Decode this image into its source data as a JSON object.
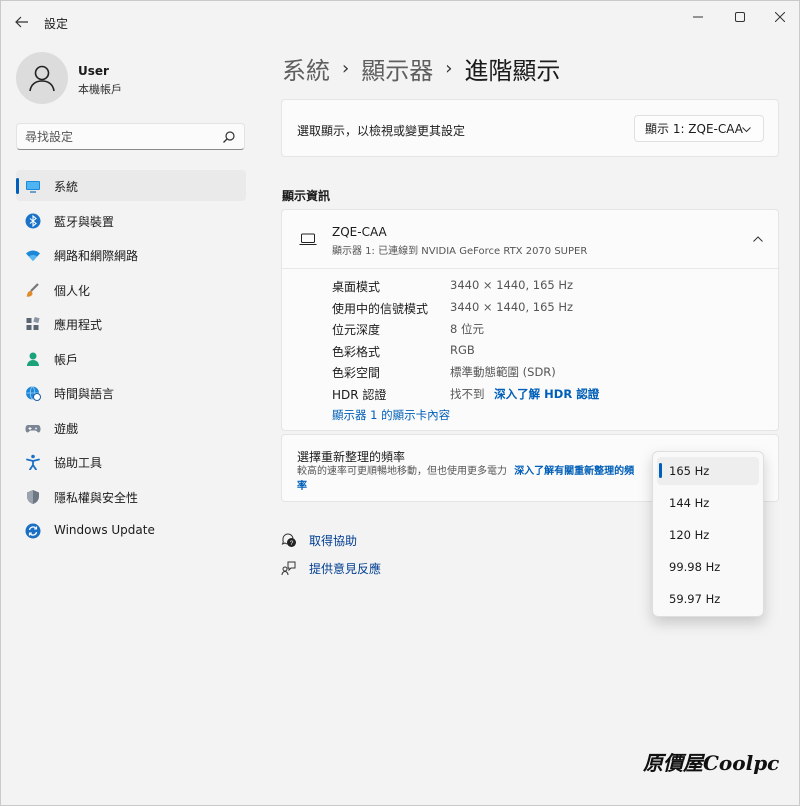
{
  "window": {
    "title": "設定",
    "controls": [
      "minimize-icon",
      "maximize-icon",
      "close-icon"
    ]
  },
  "user": {
    "name": "User",
    "account_type": "本機帳戶"
  },
  "search": {
    "placeholder": "尋找設定"
  },
  "nav": {
    "items": [
      {
        "label": "系統",
        "icon": "monitor-icon",
        "active": true
      },
      {
        "label": "藍牙與裝置",
        "icon": "bluetooth-icon"
      },
      {
        "label": "網路和網際網路",
        "icon": "wifi-icon"
      },
      {
        "label": "個人化",
        "icon": "brush-icon"
      },
      {
        "label": "應用程式",
        "icon": "apps-icon"
      },
      {
        "label": "帳戶",
        "icon": "person-icon"
      },
      {
        "label": "時間與語言",
        "icon": "globe-clock-icon"
      },
      {
        "label": "遊戲",
        "icon": "gamepad-icon"
      },
      {
        "label": "協助工具",
        "icon": "accessibility-icon"
      },
      {
        "label": "隱私權與安全性",
        "icon": "shield-icon"
      },
      {
        "label": "Windows Update",
        "icon": "update-icon"
      }
    ]
  },
  "breadcrumb": {
    "part1": "系統",
    "part2": "顯示器",
    "current": "進階顯示"
  },
  "select_display": {
    "label": "選取顯示，以檢視或變更其設定",
    "value": "顯示 1: ZQE-CAA"
  },
  "display_info": {
    "section_title": "顯示資訊",
    "monitor_name": "ZQE-CAA",
    "monitor_sub": "顯示器 1: 已連線到 NVIDIA GeForce RTX 2070 SUPER",
    "rows": [
      {
        "key": "桌面模式",
        "value": "3440 × 1440, 165 Hz"
      },
      {
        "key": "使用中的信號模式",
        "value": "3440 × 1440, 165 Hz"
      },
      {
        "key": "位元深度",
        "value": "8 位元"
      },
      {
        "key": "色彩格式",
        "value": "RGB"
      },
      {
        "key": "色彩空間",
        "value": "標準動態範圍 (SDR)"
      },
      {
        "key": "HDR 認證",
        "value": "找不到",
        "link": "深入了解 HDR 認證"
      }
    ],
    "adapter_link": "顯示器 1 的顯示卡內容"
  },
  "refresh": {
    "title": "選擇重新整理的頻率",
    "desc": "較高的速率可更順暢地移動，但也使用更多電力",
    "link": "深入了解有關重新整理的頻率",
    "options": [
      "165 Hz",
      "144 Hz",
      "120 Hz",
      "99.98 Hz",
      "59.97 Hz"
    ],
    "selected": "165 Hz"
  },
  "help": {
    "get_help": "取得協助",
    "feedback": "提供意見反應"
  },
  "watermark": "原價屋Coolpc"
}
